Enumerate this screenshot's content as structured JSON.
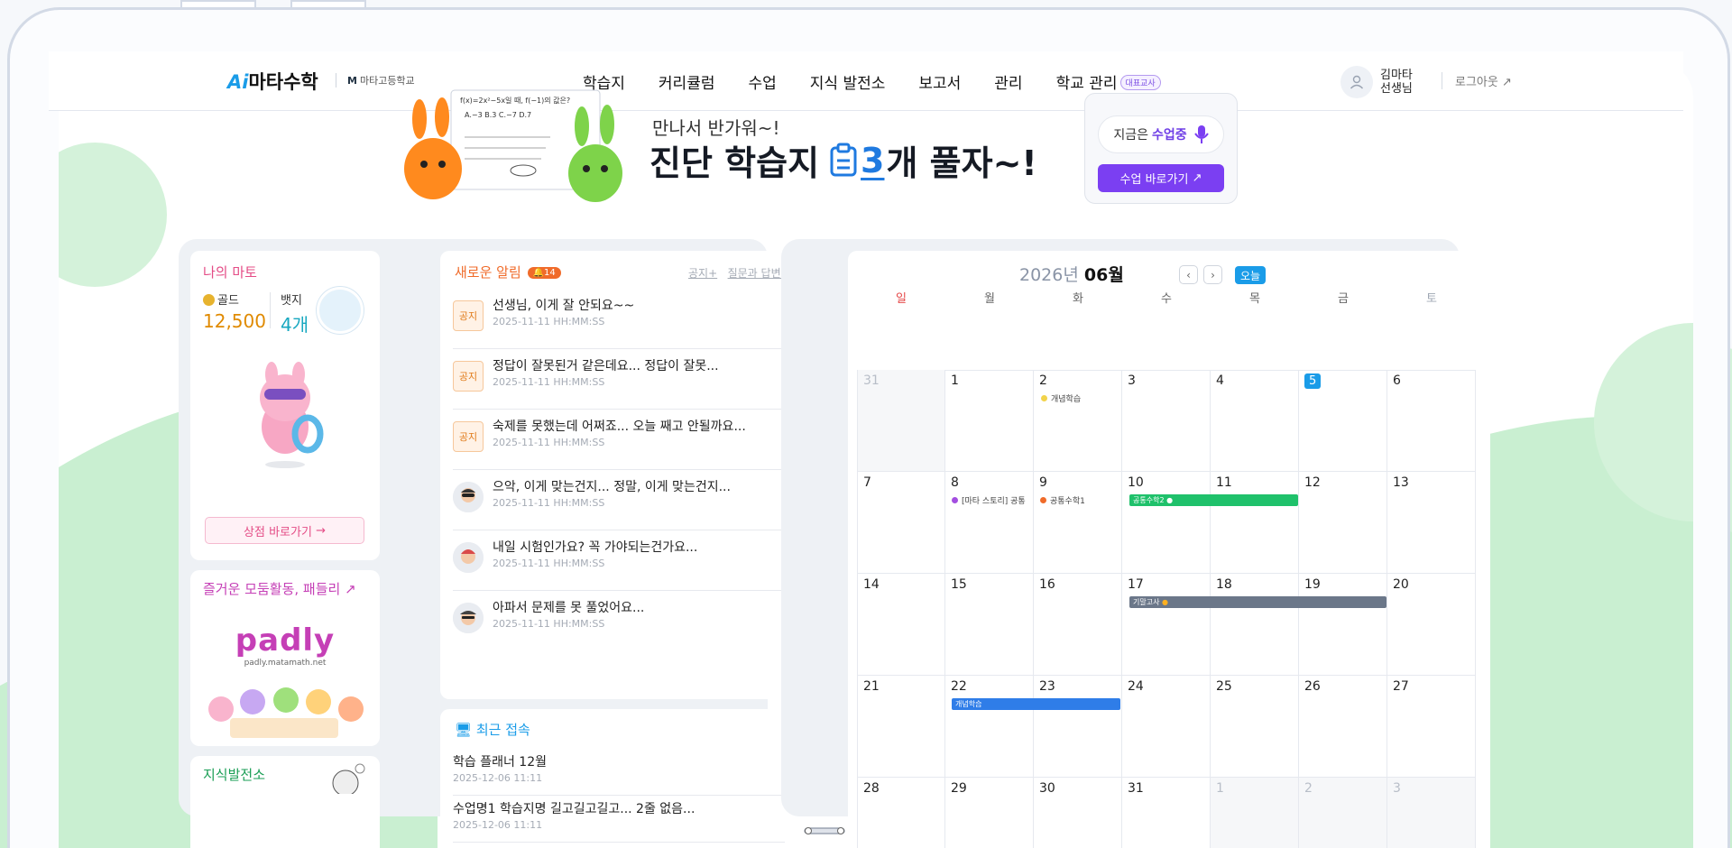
{
  "header": {
    "logo_ai": "Ai",
    "logo_text": "마타수학",
    "school_mark": "M",
    "school_name": "마타고등학교",
    "nav": [
      "학습지",
      "커리큘럼",
      "수업",
      "지식 발전소",
      "보고서",
      "관리",
      "학교 관리"
    ],
    "nav_tag": "대표교사",
    "user_name": "김마타",
    "user_role": "선생님",
    "logout": "로그아웃"
  },
  "banner": {
    "greeting": "만나서 반가워~!",
    "headline_pre": "진단 학습지",
    "count": "3",
    "headline_post": "개 풀자~!",
    "board_formula": "f(x)=2x²−5x일 때, f(−1)의 값은?",
    "board_choices": "A.−3  B.3  C.−7  D.7",
    "class_status_pre": "지금은",
    "class_status": "수업중",
    "class_button": "수업 바로가기"
  },
  "my_mato": {
    "title": "나의 마토",
    "gold_label": "골드",
    "gold_value": "12,500",
    "badge_label": "뱃지",
    "badge_value": "4개",
    "shop_button": "상점 바로가기"
  },
  "padly": {
    "title": "즐거운 모둠활동, 패들리",
    "logo": "padly",
    "url": "padly.matamath.net"
  },
  "knowledge": {
    "title": "지식발전소"
  },
  "notices": {
    "title": "새로운 알림",
    "count": "14",
    "link_notice": "공지+",
    "link_qna": "질문과 답변+",
    "items": [
      {
        "type": "tag",
        "tag": "공지",
        "text": "선생님, 이게 잘 안되요~~",
        "date": "2025-11-11 HH:MM:SS"
      },
      {
        "type": "tag",
        "tag": "공지",
        "text": "정답이 잘못된거 같은데요... 정답이 잘못...",
        "date": "2025-11-11 HH:MM:SS"
      },
      {
        "type": "tag",
        "tag": "공지",
        "text": "숙제를 못했는데 어쩌죠... 오늘 째고 안될까요...",
        "date": "2025-11-11 HH:MM:SS"
      },
      {
        "type": "face",
        "text": "으악, 이게 맞는건지... 정말, 이게 맞는건지...",
        "date": "2025-11-11 HH:MM:SS"
      },
      {
        "type": "face",
        "text": "내일 시험인가요? 꼭 가야되는건가요...",
        "date": "2025-11-11 HH:MM:SS"
      },
      {
        "type": "face",
        "text": "아파서 문제를 못 풀었어요...",
        "date": "2025-11-11 HH:MM:SS"
      }
    ]
  },
  "recent": {
    "title": "최근 접속",
    "items": [
      {
        "text": "학습 플래너 12월",
        "date": "2025-12-06 11:11"
      },
      {
        "text": "수업명1 학습지명 길고길고길고... 2줄 없음...",
        "date": "2025-12-06 11:11"
      }
    ]
  },
  "calendar": {
    "year": "2026년",
    "month": "06월",
    "today_button": "오늘",
    "weekdays": [
      "일",
      "월",
      "화",
      "수",
      "목",
      "금",
      "토"
    ],
    "weeks": [
      [
        "31",
        "1",
        "2",
        "3",
        "4",
        "5",
        "6"
      ],
      [
        "7",
        "8",
        "9",
        "10",
        "11",
        "12",
        "13"
      ],
      [
        "14",
        "15",
        "16",
        "17",
        "18",
        "19",
        "20"
      ],
      [
        "21",
        "22",
        "23",
        "24",
        "25",
        "26",
        "27"
      ],
      [
        "28",
        "29",
        "30",
        "31",
        "1",
        "2",
        "3"
      ]
    ],
    "events": {
      "e1": "개념학습",
      "e2": "[마타 스토리] 공통",
      "e3": "공통수학1",
      "e4": "공통수학2",
      "e5": "기말고사",
      "e6": "개념학습"
    },
    "colors": {
      "today": "#1a9ce8",
      "sunday": "#e54848",
      "saturday": "#a0a8b4"
    }
  }
}
